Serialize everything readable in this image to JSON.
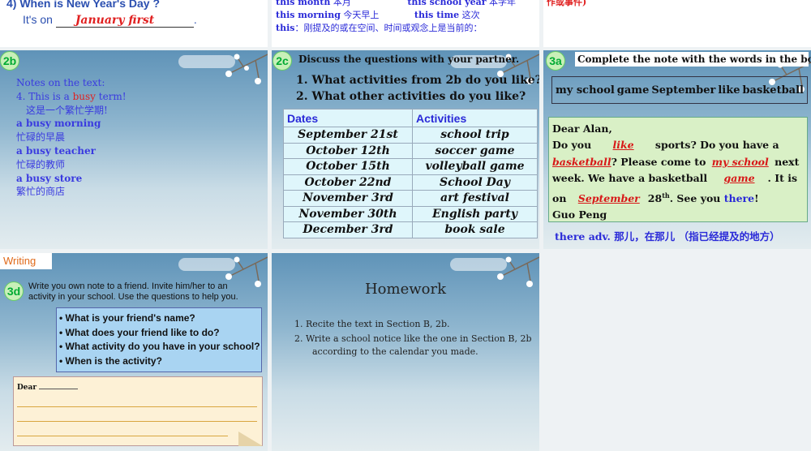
{
  "s1": {
    "q": "4) When is New Year's Day ?",
    "prefix": "It's on",
    "answer": "January first",
    "suffix": "."
  },
  "s2": {
    "a1": "this month",
    "a1cn": "本月",
    "a2": "this school year",
    "a2cn": "本学年",
    "b1": "this morning",
    "b1cn": "今天早上",
    "b2": "this time",
    "b2cn": "这次",
    "c1": "this",
    "c1cn": "：刚提及的或在空间、时间或观念上是当前的："
  },
  "s3": {
    "t": "作或事件)"
  },
  "s4": {
    "tag": "2b",
    "l1": "Notes on the text:",
    "l2a": "4. This is a ",
    "l2b": "busy",
    "l2c": " term!",
    "l3": "这是一个繁忙学期!",
    "l4": "a busy morning",
    "l5": "忙碌的早晨",
    "l6": "a busy teacher",
    "l7": "忙碌的教师",
    "l8": "a busy store",
    "l9": "繁忙的商店"
  },
  "s5": {
    "tag": "2c",
    "title": "Discuss the questions with your partner.",
    "q1": "1. What activities from 2b do you like?",
    "q2": "2. What other activities do you like?",
    "h1": "Dates",
    "h2": "Activities",
    "rows": [
      {
        "d": "September 21st",
        "a": "school trip"
      },
      {
        "d": "October 12th",
        "a": "soccer game"
      },
      {
        "d": "October 15th",
        "a": "volleyball game"
      },
      {
        "d": "October 22nd",
        "a": "School Day"
      },
      {
        "d": "November 3rd",
        "a": "art festival"
      },
      {
        "d": "November 30th",
        "a": "English party"
      },
      {
        "d": "December 3rd",
        "a": "book sale"
      }
    ]
  },
  "s6": {
    "tag": "3a",
    "title": "Complete the note with the words in the box.",
    "words": [
      "my school",
      "game",
      "September",
      "like",
      "basketball"
    ],
    "dear": "Dear Alan,",
    "l2a": "Do you ",
    "l2b": "like",
    "l2c": " sports? Do you have a",
    "l3b": "basketball",
    "l3c": "? Please come to ",
    "l3d": "my school",
    "l3e": " next",
    "l4a": "week. We have a basketball ",
    "l4b": "game",
    "l4c": ". It is",
    "l5a": "on ",
    "l5b": "September",
    "l5c": "28",
    "l5sup": "th",
    "l5d": ". See you ",
    "l5e": "there",
    "l5f": "!",
    "sign": "Guo Peng",
    "note": "there adv. 那儿，在那儿 （指已经提及的地方）"
  },
  "s7": {
    "label": "Writing",
    "tag": "3d",
    "instr": "Write you own note to a friend. Invite him/her to an activity in your school. Use the questions to help you.",
    "qs": [
      "What is your friend's name?",
      "What does your friend like to do?",
      "What activity do you have in your school?",
      "When is the activity?"
    ],
    "dear": "Dear"
  },
  "s8": {
    "title": "Homework",
    "i1": "1. Recite the text in Section B, 2b.",
    "i2": "2. Write a school notice like the one in Section B, 2b",
    "i2b": "according to the calendar you made."
  },
  "colors": {
    "red": "#e02020",
    "blue": "#2a2ad8",
    "table_bg": "#dff6fb",
    "box_bg": "#a9d4f2",
    "note_bg": "#fdf1d6"
  }
}
